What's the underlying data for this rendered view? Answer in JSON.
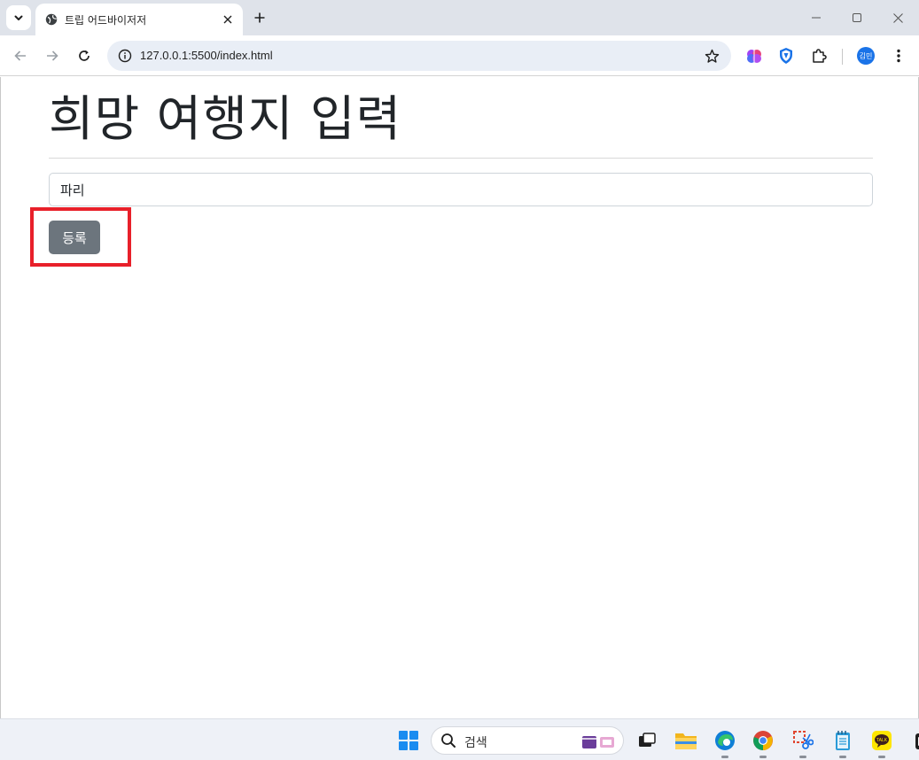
{
  "browser": {
    "tab_title": "트립 어드바이저저",
    "url": "127.0.0.1:5500/index.html",
    "profile_initials": "김민"
  },
  "page": {
    "heading": "희망 여행지 입력",
    "destination_input_value": "파리",
    "submit_label": "등록"
  },
  "taskbar": {
    "search_placeholder": "검색",
    "apps": [
      "task-view",
      "file-explorer",
      "edge",
      "chrome",
      "snipping-tool",
      "notepad",
      "kakaotalk",
      "store"
    ]
  },
  "colors": {
    "button": "#6c757d",
    "highlight": "#e8202a",
    "accent": "#1a73e8"
  }
}
